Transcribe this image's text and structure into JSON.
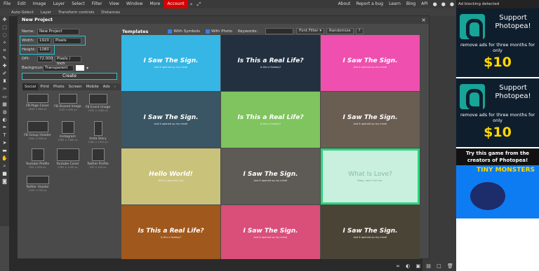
{
  "menu": {
    "items": [
      "File",
      "Edit",
      "Image",
      "Layer",
      "Select",
      "Filter",
      "View",
      "Window",
      "More"
    ],
    "account": "Account",
    "right_links": [
      "About",
      "Report a bug",
      "Learn",
      "Blog",
      "API"
    ]
  },
  "optbar": {
    "auto_select": "Auto-Select",
    "layer": "Layer",
    "transform": "Transform controls",
    "distances": "Distances"
  },
  "ads": {
    "header": "Ad blocking detected",
    "support_title": "Support Photopea!",
    "support_text": "remove ads for three months for only",
    "price": "$10",
    "game_title": "Try this game from the creators of Photopea!",
    "game_logo": "TINY MONSTERS"
  },
  "dialog": {
    "title": "New Project",
    "name_label": "Name:",
    "name_value": "New Project",
    "width_label": "Width:",
    "width_value": "1920",
    "width_unit": "Pixels",
    "height_label": "Height:",
    "height_value": "1080",
    "dpi_label": "DPI:",
    "dpi_value": "72.000",
    "dpi_unit": "Pixels / Inch",
    "background_label": "Background:",
    "background_value": "Transparent",
    "create_label": "Create",
    "categories": [
      "Social",
      "Print",
      "Photo",
      "Screen",
      "Mobile",
      "Ads"
    ],
    "presets": [
      {
        "name": "FB Page Cover",
        "size": "1640 × 664 px"
      },
      {
        "name": "FB Shared Image",
        "size": "1200 × 630 px"
      },
      {
        "name": "FB Event Image",
        "size": "1920 × 1080 px"
      },
      {
        "name": "FB Group Header",
        "size": "1640 × 856 px"
      },
      {
        "name": "Instagram",
        "size": "1080 × 1080 px"
      },
      {
        "name": "Insta Story",
        "size": "1080 × 1920 px"
      },
      {
        "name": "Youtube Profile",
        "size": "800 × 800 px"
      },
      {
        "name": "Youtube Cover",
        "size": "2560 × 1440 px"
      },
      {
        "name": "Twitter Profile",
        "size": "400 × 400 px"
      },
      {
        "name": "Twitter Header",
        "size": "1500 × 500 px"
      }
    ],
    "templates_label": "Templates",
    "with_symbols": "With Symbols",
    "with_photo": "With Photo",
    "keywords_label": "Keywords:",
    "font_filter": "Font Filter ▾",
    "randomize": "Randomize",
    "help": "?"
  },
  "templates": [
    {
      "title": "I Saw The Sign.",
      "sub": "And it opened up my mind!",
      "bg": "#35b6e5"
    },
    {
      "title": "Is This a Real Life?",
      "sub": "Is this a fantasy?",
      "bg": "#223040"
    },
    {
      "title": "I Saw The Sign.",
      "sub": "And it opened up my mind!",
      "bg": "#ef4fae"
    },
    {
      "title": "I Saw The Sign.",
      "sub": "And it opened up my mind!",
      "bg": "#3a5563"
    },
    {
      "title": "Is This a Real Life?",
      "sub": "Is this a fantasy?",
      "bg": "#7fc45e"
    },
    {
      "title": "I Saw The Sign.",
      "sub": "And it opened up my mind!",
      "bg": "#6a5d52"
    },
    {
      "title": "Hello World!",
      "sub": "What a beautiful day",
      "bg": "#c9c27b"
    },
    {
      "title": "I Saw The Sign.",
      "sub": "And it opened up my mind!",
      "bg": "#5e5a55"
    },
    {
      "title": "What Is Love?",
      "sub": "Baby, don't hurt me.",
      "bg": "#c9f0de"
    },
    {
      "title": "Is This a Real Life?",
      "sub": "Is this a fantasy?",
      "bg": "#a0581c"
    },
    {
      "title": "I Saw The Sign.",
      "sub": "And it opened up my mind!",
      "bg": "#d94f7a"
    },
    {
      "title": "I Saw The Sign.",
      "sub": "And it opened up my mind!",
      "bg": "#4a4436"
    }
  ]
}
